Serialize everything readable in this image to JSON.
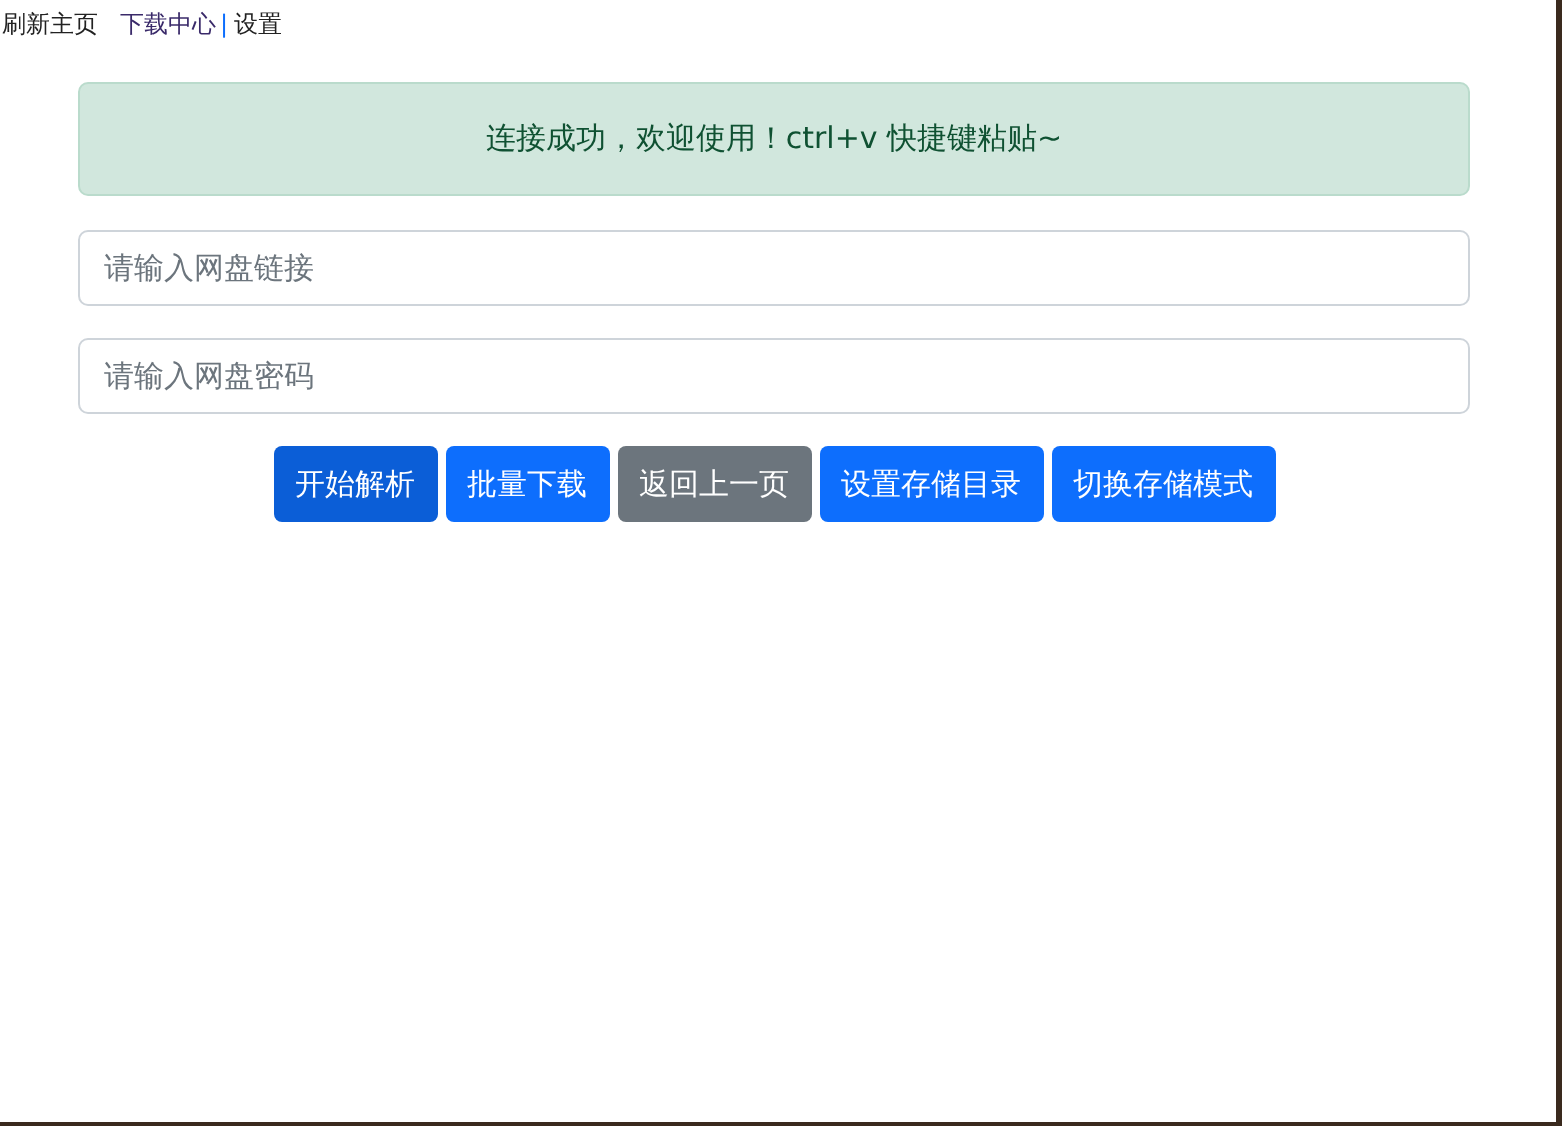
{
  "top_links": [
    {
      "label": "刷新主页",
      "visited": false
    },
    {
      "label": "下载中心",
      "visited": true
    },
    {
      "label": "设置",
      "visited": false
    }
  ],
  "separator": "|",
  "alert": {
    "text": "连接成功，欢迎使用！ctrl+v 快捷键粘贴~"
  },
  "fields": [
    {
      "placeholder": "请输入网盘链接"
    },
    {
      "placeholder": "请输入网盘密码"
    }
  ],
  "buttons": [
    {
      "label": "开始解析",
      "kind": "primary",
      "focused": true
    },
    {
      "label": "批量下载",
      "kind": "primary",
      "focused": false
    },
    {
      "label": "返回上一页",
      "kind": "secondary",
      "focused": false
    },
    {
      "label": "设置存储目录",
      "kind": "primary",
      "focused": false
    },
    {
      "label": "切换存储模式",
      "kind": "primary",
      "focused": false
    }
  ]
}
